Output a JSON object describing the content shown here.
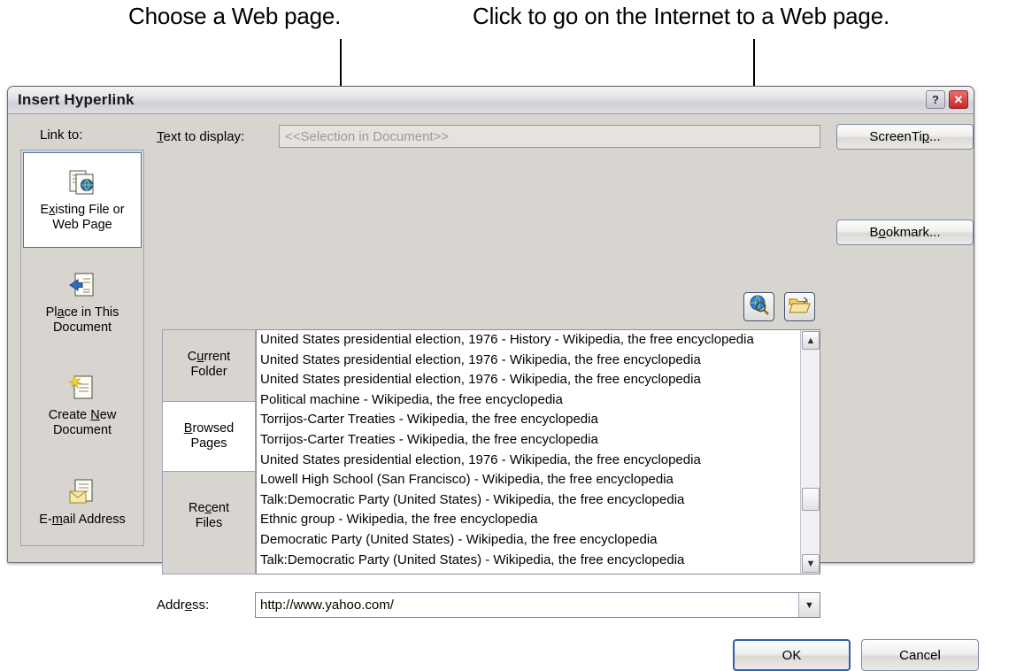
{
  "annotations": {
    "left": "Choose a Web page.",
    "right": "Click to go on the Internet to a Web page."
  },
  "dialog": {
    "title": "Insert Hyperlink",
    "titlebar_buttons": [
      {
        "name": "help-button",
        "glyph": "?"
      },
      {
        "name": "close-button",
        "glyph": "✕"
      }
    ]
  },
  "link_to": {
    "label": "Link to:",
    "items": [
      {
        "label": "Existing File or Web Page",
        "icon": "document-globe-icon",
        "selected": true
      },
      {
        "label": "Place in This Document",
        "icon": "document-arrow-icon",
        "selected": false
      },
      {
        "label": "Create New Document",
        "icon": "new-document-icon",
        "selected": false
      },
      {
        "label": "E-mail Address",
        "icon": "document-envelope-icon",
        "selected": false
      }
    ]
  },
  "text_to_display": {
    "label": "Text to display:",
    "value": "<<Selection in Document>>"
  },
  "buttons": {
    "screentip": "ScreenTip...",
    "bookmark": "Bookmark...",
    "ok": "OK",
    "cancel": "Cancel"
  },
  "browse_icons": [
    {
      "name": "browse-the-web-icon",
      "label": "Browse the Web"
    },
    {
      "name": "browse-for-file-icon",
      "label": "Browse for File"
    }
  ],
  "tabs": [
    {
      "label_line1": "Current",
      "label_line2": "Folder",
      "selected": false
    },
    {
      "label_line1": "Browsed",
      "label_line2": "Pages",
      "selected": true
    },
    {
      "label_line1": "Recent",
      "label_line2": "Files",
      "selected": false
    }
  ],
  "list": {
    "items": [
      "United States presidential election, 1976 - History - Wikipedia, the free encyclopedia",
      "United States presidential election, 1976 - Wikipedia, the free encyclopedia",
      "United States presidential election, 1976 - Wikipedia, the free encyclopedia",
      "Political machine - Wikipedia, the free encyclopedia",
      "Torrijos-Carter Treaties - Wikipedia, the free encyclopedia",
      "Torrijos-Carter Treaties - Wikipedia, the free encyclopedia",
      "United States presidential election, 1976 - Wikipedia, the free encyclopedia",
      "Lowell High School (San Francisco) - Wikipedia, the free encyclopedia",
      "Talk:Democratic Party (United States) - Wikipedia, the free encyclopedia",
      "Ethnic group - Wikipedia, the free encyclopedia",
      "Democratic Party (United States) - Wikipedia, the free encyclopedia",
      "Talk:Democratic Party (United States) - Wikipedia, the free encyclopedia"
    ]
  },
  "address": {
    "label": "Address:",
    "value": "http://www.yahoo.com/"
  },
  "colors": {
    "dialog_face": "#d8d5d0",
    "accent_border": "#4f76a8",
    "default_button_border": "#2f5fa8",
    "close_button": "#c5282a",
    "disabled_text": "#9d9a96"
  }
}
